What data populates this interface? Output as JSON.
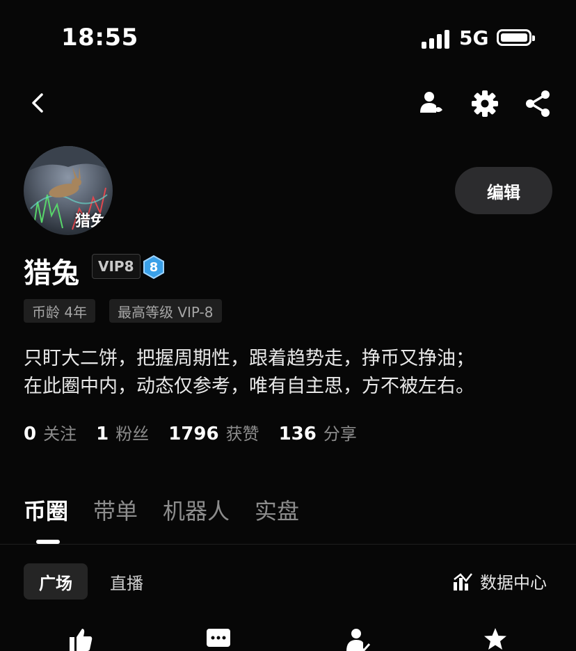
{
  "status_bar": {
    "time": "18:55",
    "network": "5G"
  },
  "header": {
    "back_icon": "chevron-left-icon",
    "icons": [
      "person-icon",
      "gear-icon",
      "share-icon"
    ]
  },
  "profile": {
    "avatar_text": "猎兔",
    "edit_label": "编辑",
    "username": "猎兔",
    "vip_badge": "VIP8",
    "level": "8",
    "tags": [
      "币龄 4年",
      "最高等级 VIP-8"
    ],
    "bio_lines": [
      "只盯大二饼，把握周期性，跟着趋势走，挣币又挣油；",
      "在此圈中内，动态仅参考，唯有自主思，方不被左右。"
    ],
    "stats": [
      {
        "value": "0",
        "label": "关注"
      },
      {
        "value": "1",
        "label": "粉丝"
      },
      {
        "value": "1796",
        "label": "获赞"
      },
      {
        "value": "136",
        "label": "分享"
      }
    ]
  },
  "tabs": [
    {
      "label": "币圈",
      "active": true
    },
    {
      "label": "带单",
      "active": false
    },
    {
      "label": "机器人",
      "active": false
    },
    {
      "label": "实盘",
      "active": false
    }
  ],
  "subtabs": [
    {
      "label": "广场",
      "active": true
    },
    {
      "label": "直播",
      "active": false
    }
  ],
  "data_center_label": "数据中心",
  "bottom_icons": [
    "thumbs-up-icon",
    "comment-icon",
    "user-check-icon",
    "star-icon"
  ]
}
